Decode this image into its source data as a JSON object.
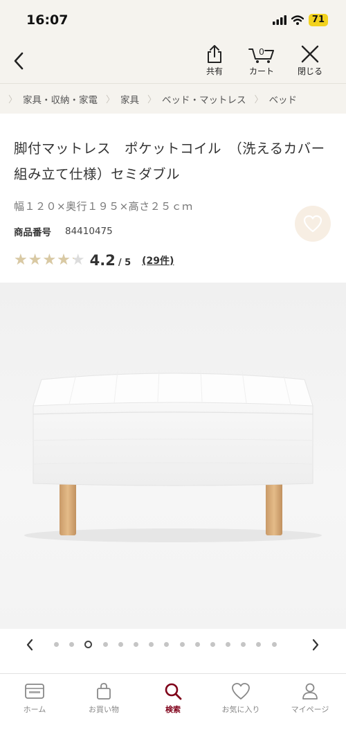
{
  "status_bar": {
    "time": "16:07",
    "battery": "71"
  },
  "header": {
    "share_label": "共有",
    "cart_label": "カート",
    "cart_count": "0",
    "close_label": "閉じる"
  },
  "breadcrumb": [
    "家具・収納・家電",
    "家具",
    "ベッド・マットレス",
    "ベッド"
  ],
  "product": {
    "title": "脚付マットレス　ポケットコイル　（洗えるカバー　組み立て仕様）セミダブル",
    "size": "幅１２０×奥行１９５×高さ２５ｃｍ",
    "number_label": "商品番号",
    "number": "84410475",
    "rating": 4.2,
    "rating_text": "4.2",
    "rating_max": "/ 5",
    "reviews": "(29件)"
  },
  "gallery": {
    "count": 15,
    "active_index": 2
  },
  "bottom_nav": [
    {
      "label": "ホーム",
      "icon": "home-card-icon"
    },
    {
      "label": "お買い物",
      "icon": "shopping-bag-icon"
    },
    {
      "label": "検索",
      "icon": "search-icon"
    },
    {
      "label": "お気に入り",
      "icon": "heart-icon"
    },
    {
      "label": "マイページ",
      "icon": "person-icon"
    }
  ],
  "colors": {
    "accent": "#7f0019",
    "header_bg": "#f5f3ee",
    "star": "#d9c9a3",
    "fav_bg": "#f7eee3"
  }
}
